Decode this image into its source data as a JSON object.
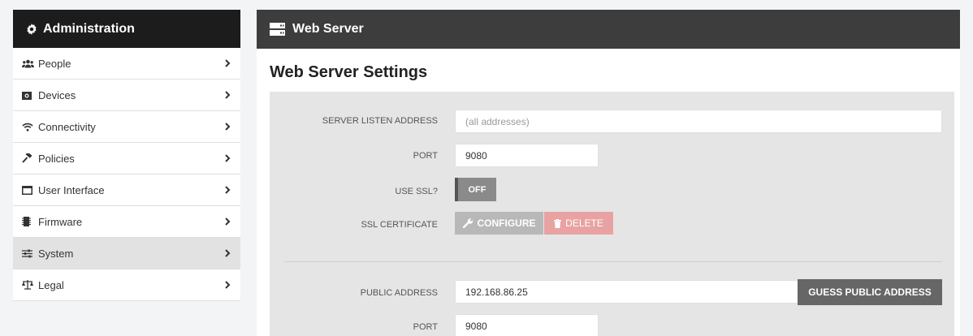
{
  "sidebar": {
    "title": "Administration",
    "title_icon": "gear-icon",
    "items": [
      {
        "label": "People",
        "icon": "people-icon"
      },
      {
        "label": "Devices",
        "icon": "camera-icon"
      },
      {
        "label": "Connectivity",
        "icon": "wifi-icon"
      },
      {
        "label": "Policies",
        "icon": "gavel-icon"
      },
      {
        "label": "User Interface",
        "icon": "window-icon"
      },
      {
        "label": "Firmware",
        "icon": "chip-icon"
      },
      {
        "label": "System",
        "icon": "sliders-icon",
        "active": true
      },
      {
        "label": "Legal",
        "icon": "scales-icon"
      }
    ]
  },
  "main": {
    "header_title": "Web Server",
    "header_icon": "server-icon",
    "page_title": "Web Server Settings",
    "fields": {
      "listen_address_label": "SERVER LISTEN ADDRESS",
      "listen_address_placeholder": "(all addresses)",
      "port_label": "PORT",
      "port_value": "9080",
      "use_ssl_label": "USE SSL?",
      "use_ssl_state": "OFF",
      "ssl_cert_label": "SSL CERTIFICATE",
      "configure_label": "CONFIGURE",
      "delete_label": "DELETE",
      "public_address_label": "PUBLIC ADDRESS",
      "public_address_value": "192.168.86.25",
      "guess_label": "GUESS PUBLIC ADDRESS",
      "public_port_label": "PORT",
      "public_port_value": "9080"
    }
  },
  "colors": {
    "sidebar_header_bg": "#1c1c1c",
    "main_header_bg": "#3d3d3d",
    "active_item_bg": "#e2e2e2",
    "delete_button": "#e8a2a2",
    "guess_button": "#666666"
  }
}
